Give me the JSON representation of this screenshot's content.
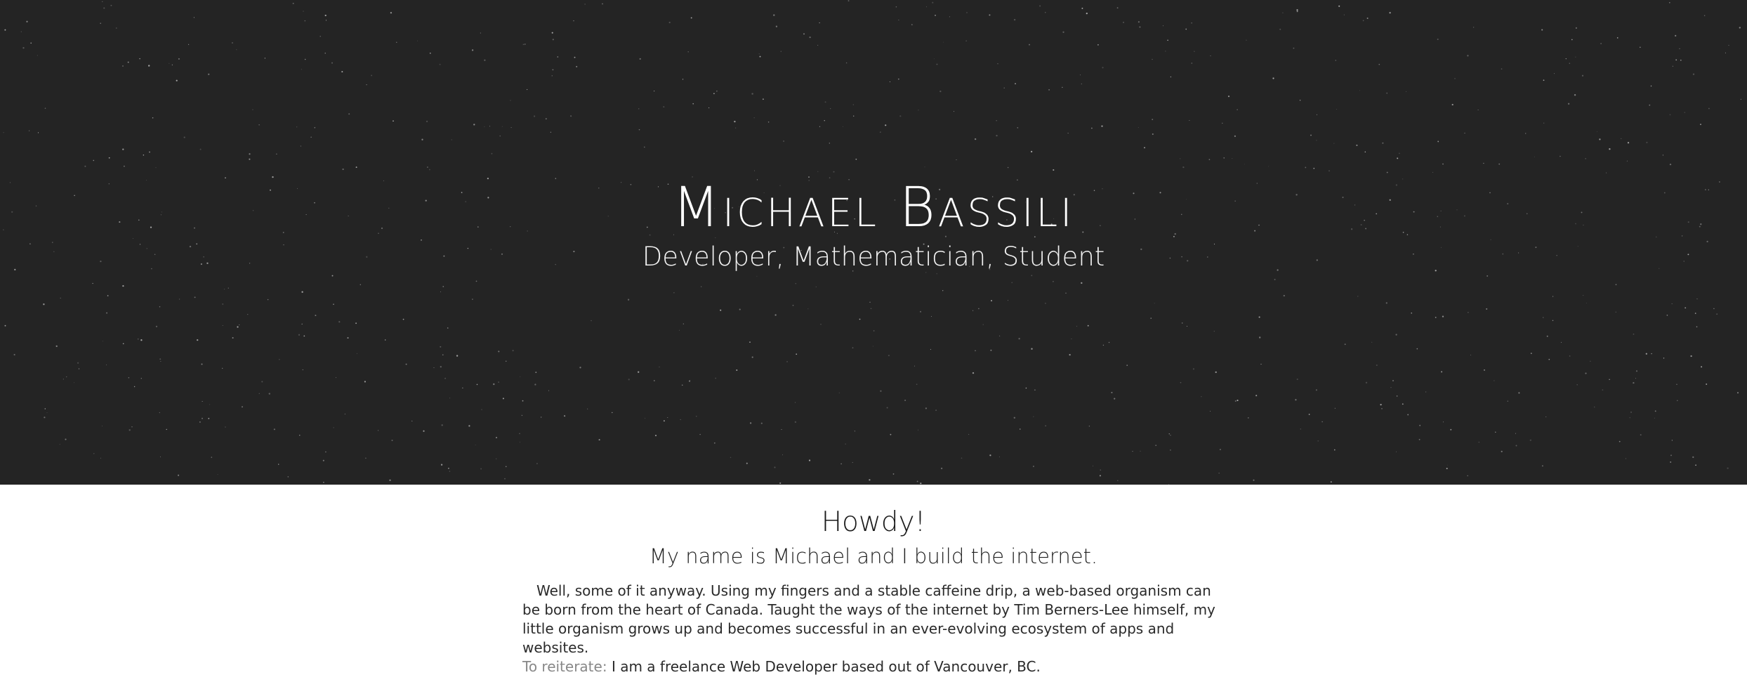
{
  "hero": {
    "title": "Michael Bassili",
    "subtitle": "Developer, Mathematician, Student",
    "background_color": "#242424"
  },
  "about": {
    "greeting": "Howdy!",
    "intro": "My name is Michael and I build the internet.",
    "body": "Well, some of it anyway. Using my fingers and a stable caffeine drip, a web-based organism can be born from the heart of Canada. Taught the ways of the internet by Tim Berners-Lee himself, my little organism grows up and becomes successful in an ever-evolving ecosystem of apps and websites.",
    "reiterate_label": "To reiterate:",
    "reiterate_text": "I am a freelance Web Developer based out of Vancouver, BC."
  }
}
